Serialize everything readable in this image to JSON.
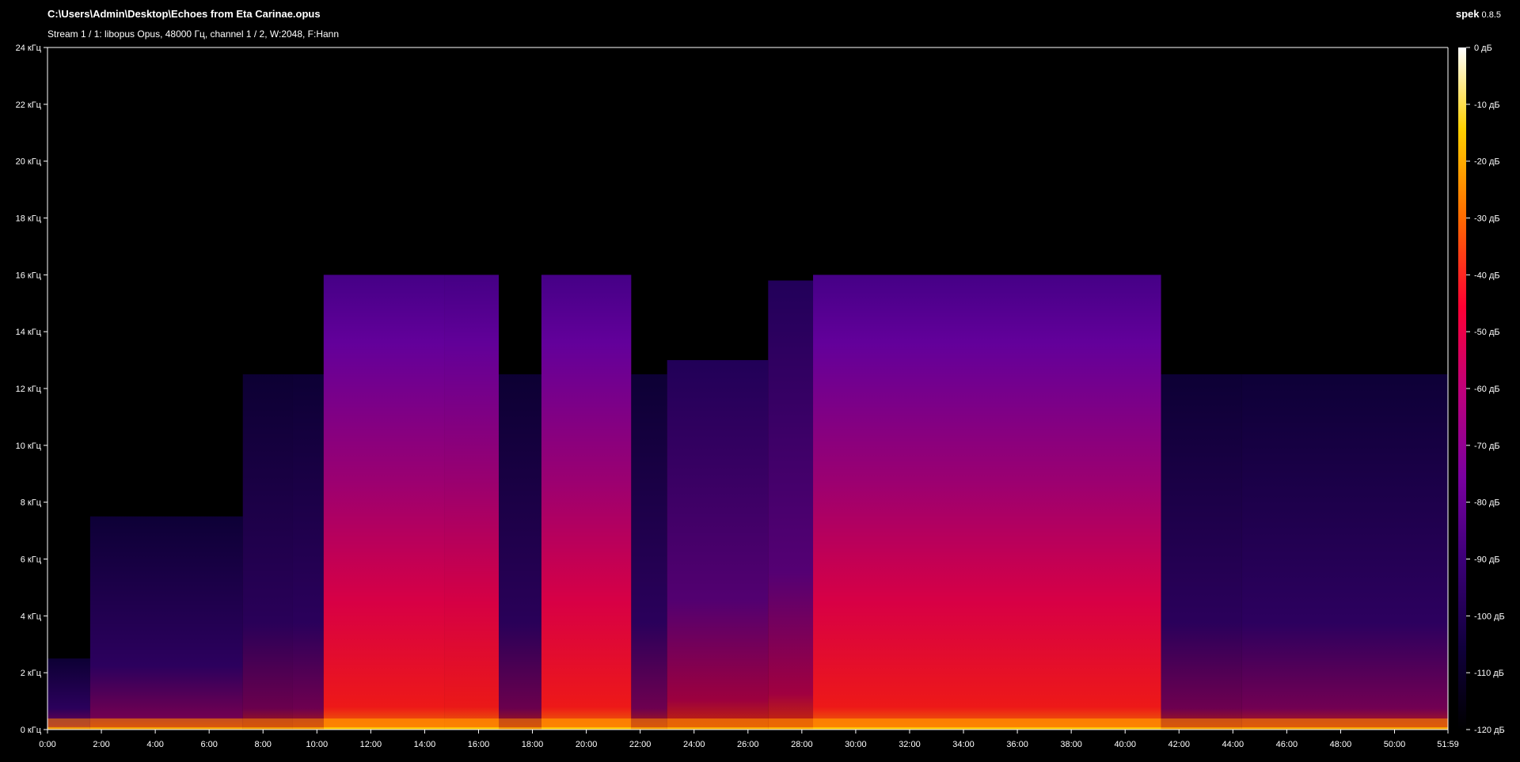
{
  "header": {
    "file_path": "C:\\Users\\Admin\\Desktop\\Echoes from Eta Carinae.opus",
    "stream_info": "Stream 1 / 1: libopus Opus, 48000 Гц, channel 1 / 2, W:2048, F:Hann"
  },
  "brand": {
    "name": "spek",
    "version": "0.8.5"
  },
  "colors": {
    "background": "#000000",
    "axis": "#ffffff",
    "palette": [
      "#000000",
      "#10003c",
      "#3c0078",
      "#7a00a0",
      "#c0007a",
      "#ff0033",
      "#ff6a00",
      "#ffd000",
      "#ffffff"
    ]
  },
  "chart_data": {
    "type": "heatmap",
    "title": "",
    "x_ticks": [
      "0:00",
      "2:00",
      "4:00",
      "6:00",
      "8:00",
      "10:00",
      "12:00",
      "14:00",
      "16:00",
      "18:00",
      "20:00",
      "22:00",
      "24:00",
      "26:00",
      "28:00",
      "30:00",
      "32:00",
      "34:00",
      "36:00",
      "38:00",
      "40:00",
      "42:00",
      "44:00",
      "46:00",
      "48:00",
      "50:00",
      "51:59"
    ],
    "y_ticks": [
      "0 кГц",
      "2 кГц",
      "4 кГц",
      "6 кГц",
      "8 кГц",
      "10 кГц",
      "12 кГц",
      "14 кГц",
      "16 кГц",
      "18 кГц",
      "20 кГц",
      "22 кГц",
      "24 кГц"
    ],
    "colorbar_ticks": [
      "0 дБ",
      "-10 дБ",
      "-20 дБ",
      "-30 дБ",
      "-40 дБ",
      "-50 дБ",
      "-60 дБ",
      "-70 дБ",
      "-80 дБ",
      "-90 дБ",
      "-100 дБ",
      "-110 дБ",
      "-120 дБ"
    ],
    "x_range_seconds": [
      0,
      3119
    ],
    "y_range_khz": [
      0,
      24
    ],
    "db_range": [
      -120,
      0
    ],
    "segments": [
      {
        "start": 0,
        "end": 95,
        "cutoff_khz": 2.5,
        "intensity": 0.35
      },
      {
        "start": 95,
        "end": 435,
        "cutoff_khz": 7.5,
        "intensity": 0.4
      },
      {
        "start": 435,
        "end": 545,
        "cutoff_khz": 12.5,
        "intensity": 0.3
      },
      {
        "start": 545,
        "end": 615,
        "cutoff_khz": 12.5,
        "intensity": 0.35
      },
      {
        "start": 615,
        "end": 885,
        "cutoff_khz": 16,
        "intensity": 0.85
      },
      {
        "start": 885,
        "end": 1005,
        "cutoff_khz": 16,
        "intensity": 0.82
      },
      {
        "start": 1005,
        "end": 1100,
        "cutoff_khz": 12.5,
        "intensity": 0.3
      },
      {
        "start": 1100,
        "end": 1300,
        "cutoff_khz": 16,
        "intensity": 0.85
      },
      {
        "start": 1300,
        "end": 1380,
        "cutoff_khz": 12.5,
        "intensity": 0.35
      },
      {
        "start": 1380,
        "end": 1605,
        "cutoff_khz": 13,
        "intensity": 0.5
      },
      {
        "start": 1605,
        "end": 1705,
        "cutoff_khz": 15.8,
        "intensity": 0.55
      },
      {
        "start": 1705,
        "end": 2480,
        "cutoff_khz": 16,
        "intensity": 0.85
      },
      {
        "start": 2480,
        "end": 2660,
        "cutoff_khz": 12.5,
        "intensity": 0.35
      },
      {
        "start": 2660,
        "end": 3119,
        "cutoff_khz": 12.5,
        "intensity": 0.42
      }
    ]
  }
}
